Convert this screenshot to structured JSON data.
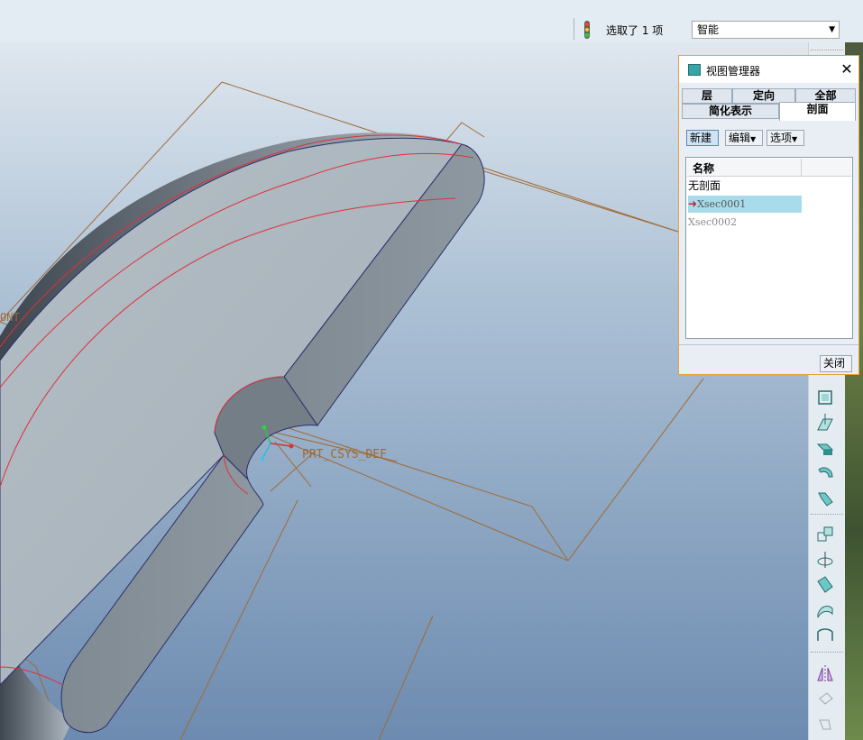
{
  "topbar": {
    "selection_text": "选取了 1 项",
    "filter_value": "智能"
  },
  "viewport": {
    "csys_label": "PRT_CSYS_DEF",
    "plane_label_left": "ONT",
    "colors": {
      "model": "#a8b4bd",
      "edge": "#e0303a",
      "datum": "#a06a35",
      "background": "#8aa4c1"
    }
  },
  "dialog": {
    "title": "视图管理器",
    "tabs_row1": [
      "层",
      "定向",
      "全部"
    ],
    "tabs_row2": [
      "简化表示",
      "剖面"
    ],
    "active_tab": "剖面",
    "buttons": {
      "new": "新建",
      "edit": "编辑",
      "options": "选项",
      "close": "关闭"
    },
    "list": {
      "header": "名称",
      "items": [
        "无剖面",
        "Xsec0001",
        "Xsec0002"
      ],
      "selected": "Xsec0001"
    }
  },
  "right_toolbar": {
    "icons": [
      "plane-icon",
      "datum-plane-icon",
      "extrude-icon",
      "revolve-icon",
      "sweep-icon",
      "pattern-icon",
      "axis-icon",
      "draft-icon",
      "surface-icon",
      "shell-icon",
      "mirror-icon",
      "merge-icon",
      "trim-icon"
    ]
  }
}
